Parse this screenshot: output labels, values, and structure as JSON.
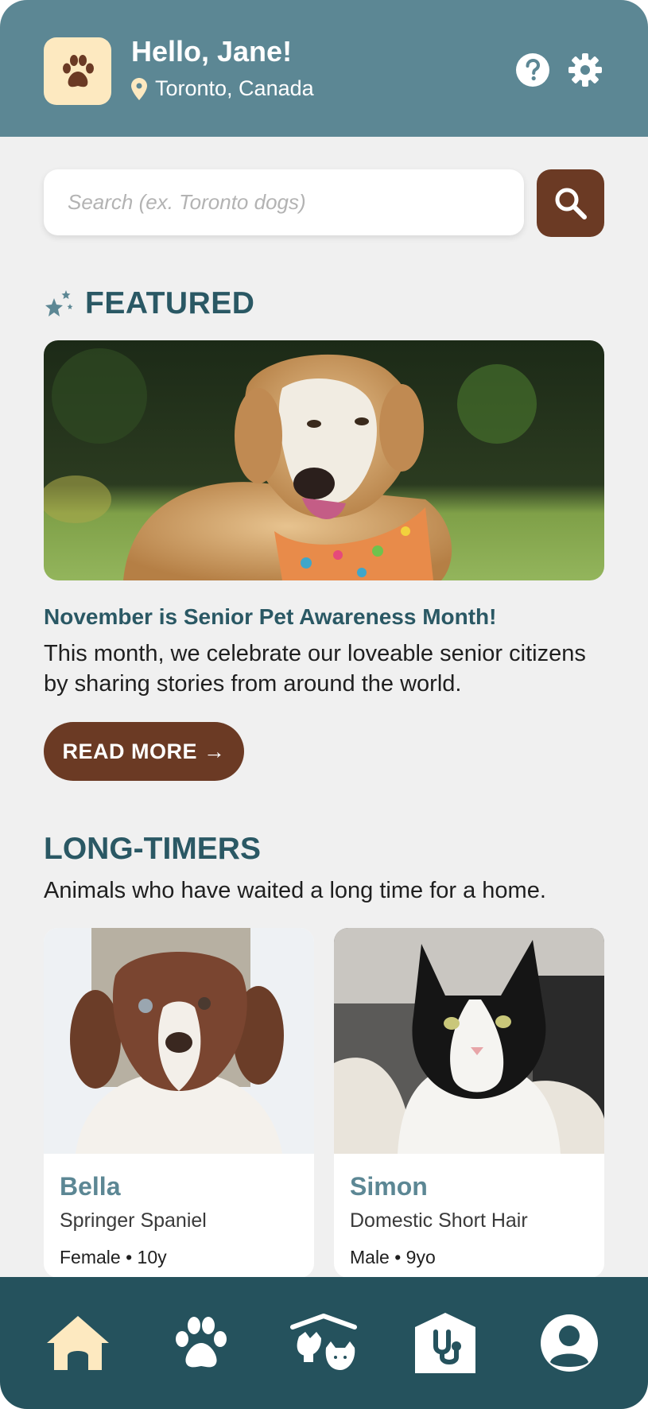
{
  "header": {
    "greeting": "Hello, Jane!",
    "location": "Toronto, Canada",
    "logo_icon": "paw-icon",
    "help_icon": "help-icon",
    "settings_icon": "gear-icon"
  },
  "search": {
    "placeholder": "Search (ex. Toronto dogs)",
    "button_icon": "search-icon"
  },
  "featured": {
    "heading": "FEATURED",
    "heading_icon": "sparkle-star-icon",
    "article_title": "November is Senior Pet Awareness Month!",
    "article_body": "This month, we celebrate our loveable senior citizens by sharing stories from around the world.",
    "read_more_label": "READ MORE →"
  },
  "long_timers": {
    "heading": "LONG-TIMERS",
    "subtitle": "Animals who have waited a long time for a home.",
    "pets": [
      {
        "name": "Bella",
        "breed": "Springer Spaniel",
        "meta": "Female • 10y"
      },
      {
        "name": "Simon",
        "breed": "Domestic Short Hair",
        "meta": "Male • 9yo"
      }
    ]
  },
  "nav": {
    "items": [
      "home-icon",
      "paw-icon",
      "shelter-icon",
      "vet-icon",
      "profile-icon"
    ],
    "active": "home-icon"
  },
  "colors": {
    "header_bg": "#5c8794",
    "nav_bg": "#25525d",
    "accent_brown": "#6b3a24",
    "heading_teal": "#2a5864",
    "cream": "#fde9c0"
  }
}
